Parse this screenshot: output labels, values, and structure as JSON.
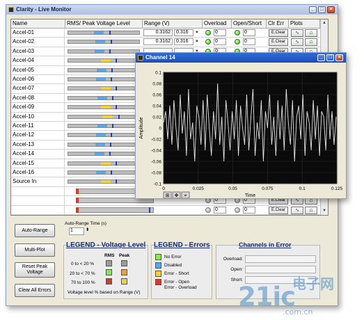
{
  "main_window": {
    "title": "Clarity - Live Monitor",
    "title_buttons": [
      "_",
      "□",
      "×"
    ]
  },
  "columns": [
    "Name",
    "RMS/ Peak Voltage Level",
    "Range (V)",
    "Overload",
    "Open/Short",
    "Clr Err",
    "Plots"
  ],
  "channels": [
    {
      "name": "Accel-01",
      "rms": 0.45,
      "peak": 0.58,
      "color": "blue",
      "range_value": "0.3162",
      "range_select": "0.316"
    },
    {
      "name": "Accel-02",
      "rms": 0.47,
      "peak": 0.6,
      "color": "blue",
      "range_value": "0.3162",
      "range_select": "0.316"
    },
    {
      "name": "Accel-03",
      "rms": 0.46,
      "peak": 0.58,
      "color": "blue",
      "range_value": "",
      "range_select": ""
    },
    {
      "name": "Accel-04",
      "rms": 0.55,
      "peak": 0.67,
      "color": "yellow",
      "range_value": "",
      "range_select": ""
    },
    {
      "name": "Accel-05",
      "rms": 0.49,
      "peak": 0.61,
      "color": "blue",
      "range_value": "",
      "range_select": ""
    },
    {
      "name": "Accel-06",
      "rms": 0.48,
      "peak": 0.6,
      "color": "blue",
      "range_value": "",
      "range_select": ""
    },
    {
      "name": "Accel-07",
      "rms": 0.55,
      "peak": 0.67,
      "color": "yellow",
      "range_value": "",
      "range_select": ""
    },
    {
      "name": "Accel-08",
      "rms": 0.5,
      "peak": 0.62,
      "color": "blue",
      "range_value": "",
      "range_select": ""
    },
    {
      "name": "Accel-09",
      "rms": 0.55,
      "peak": 0.67,
      "color": "yellow",
      "range_value": "",
      "range_select": ""
    },
    {
      "name": "Accel-10",
      "rms": 0.58,
      "peak": 0.71,
      "color": "yellow",
      "range_value": "",
      "range_select": ""
    },
    {
      "name": "Accel-11",
      "rms": 0.5,
      "peak": 0.62,
      "color": "blue",
      "range_value": "",
      "range_select": ""
    },
    {
      "name": "Accel-12",
      "rms": 0.48,
      "peak": 0.6,
      "color": "blue",
      "range_value": "",
      "range_select": ""
    },
    {
      "name": "Accel-13",
      "rms": 0.47,
      "peak": 0.59,
      "color": "blue",
      "range_value": "",
      "range_select": ""
    },
    {
      "name": "Accel-14",
      "rms": 0.46,
      "peak": 0.58,
      "color": "blue",
      "range_value": "",
      "range_select": ""
    },
    {
      "name": "Accel-15",
      "rms": 0.55,
      "peak": 0.67,
      "color": "yellow",
      "range_value": "",
      "range_select": ""
    },
    {
      "name": "Accel-16",
      "rms": 0.48,
      "peak": 0.6,
      "color": "blue",
      "range_value": "",
      "range_select": ""
    },
    {
      "name": "Source In",
      "rms": 0.55,
      "peak": 0.67,
      "color": "yellow",
      "range_value": "",
      "range_select": ""
    }
  ],
  "right_columns": {
    "overload_value": "0",
    "open_short_value": "0",
    "clear_label": "E.Clear"
  },
  "buttons": {
    "auto_range": "Auto-Range",
    "multi_plot": "Multi-Plot",
    "reset_peak": "Reset Peak Voltage",
    "clear_errors": "Clear All Errors"
  },
  "auto_range_time": {
    "label": "Auto-Range Time (s)",
    "value": "1"
  },
  "legend_voltage": {
    "title": "LEGEND - Voltage Level",
    "col_rms": "RMS",
    "col_peak": "Peak",
    "rows": [
      "0 to < 20 %",
      "20 to < 70 %",
      "70 to 100 %"
    ],
    "footnote": "Voltage level % based on Range (V)",
    "colors": {
      "low": "#9c9c9c",
      "mid": "#5aa6e8",
      "high": "#f2d23a",
      "low_peak": "#f2a13a",
      "high_peak": "#d83a22",
      "green": "#2e9b2e"
    }
  },
  "legend_errors": {
    "title": "LEGEND - Errors",
    "items": [
      {
        "label": "No Error",
        "color": "#8ae94e"
      },
      {
        "label": "Disabled",
        "color": "#5aa6e8"
      },
      {
        "label": "Error - Short",
        "color": "#f2d23a"
      },
      {
        "label": "Error - Open\nError - Overload",
        "color": "#d83a22"
      }
    ]
  },
  "channels_in_error": {
    "title": "Channels in Error",
    "fields": [
      "Overload:",
      "Open:",
      "Short:"
    ]
  },
  "chart_window": {
    "title": "Channel 14",
    "title_buttons": [
      "_",
      "□",
      "×"
    ]
  },
  "chart_data": {
    "type": "line",
    "title": "",
    "xlabel": "Time",
    "ylabel": "Amplitude",
    "xlim": [
      0,
      0.125
    ],
    "ylim": [
      -0.1,
      0.1
    ],
    "x_ticks": [
      "0",
      "0.025",
      "0.05",
      "0.075",
      "0.1",
      "0.125"
    ],
    "y_ticks": [
      "0.1",
      "0.08",
      "0.06",
      "0.04",
      "0.02",
      "0",
      "-0.02",
      "-0.04",
      "-0.06",
      "-0.08",
      "-0.1"
    ],
    "series": [
      {
        "values_note": "",
        "color": "#e8e8e8",
        "x": [
          0,
          0.0015,
          0.003,
          0.0045,
          0.006,
          0.0075,
          0.009,
          0.0105,
          0.012,
          0.0135,
          0.015,
          0.0165,
          0.018,
          0.0195,
          0.021,
          0.0225,
          0.024,
          0.0255,
          0.027,
          0.0285,
          0.03,
          0.0315,
          0.033,
          0.0345,
          0.036,
          0.0375,
          0.039,
          0.0405,
          0.042,
          0.0435,
          0.045,
          0.0465,
          0.048,
          0.0495,
          0.051,
          0.0525,
          0.054,
          0.0555,
          0.057,
          0.0585,
          0.06,
          0.0615,
          0.063,
          0.0645,
          0.066,
          0.0675,
          0.069,
          0.0705,
          0.072,
          0.0735,
          0.075,
          0.0765,
          0.078,
          0.0795,
          0.081,
          0.0825,
          0.084,
          0.0855,
          0.087,
          0.0885,
          0.09,
          0.0915,
          0.093,
          0.0945,
          0.096,
          0.0975,
          0.099,
          0.1005,
          0.102,
          0.1035,
          0.105,
          0.1065,
          0.108,
          0.1095,
          0.111,
          0.1125,
          0.114,
          0.1155,
          0.117,
          0.1185,
          0.12,
          0.1215,
          0.123,
          0.1245
        ],
        "y": [
          0.01,
          0.03,
          -0.02,
          0.04,
          -0.03,
          0.05,
          0.0,
          -0.04,
          0.06,
          -0.01,
          0.03,
          -0.05,
          0.07,
          -0.02,
          0.01,
          -0.06,
          0.04,
          0.02,
          -0.03,
          0.05,
          -0.04,
          0.06,
          0.0,
          -0.05,
          0.03,
          -0.02,
          0.08,
          -0.03,
          0.02,
          -0.06,
          0.05,
          0.01,
          -0.04,
          0.03,
          -0.02,
          0.05,
          -0.05,
          0.04,
          0.0,
          -0.03,
          0.06,
          -0.04,
          0.02,
          0.07,
          -0.05,
          0.01,
          -0.02,
          0.05,
          -0.06,
          0.03,
          0.0,
          0.06,
          -0.03,
          0.02,
          -0.05,
          0.05,
          -0.02,
          0.04,
          -0.04,
          0.07,
          0.01,
          -0.03,
          0.05,
          -0.06,
          0.02,
          0.04,
          -0.02,
          0.06,
          -0.05,
          0.03,
          0.01,
          -0.04,
          0.05,
          -0.02,
          0.04,
          -0.05,
          0.03,
          0.02,
          -0.04,
          0.06,
          -0.02,
          0.03,
          -0.03,
          0.02
        ]
      }
    ]
  },
  "watermark": {
    "brand": "21ic",
    "top": "电子网",
    "sub": ".com.cn"
  }
}
